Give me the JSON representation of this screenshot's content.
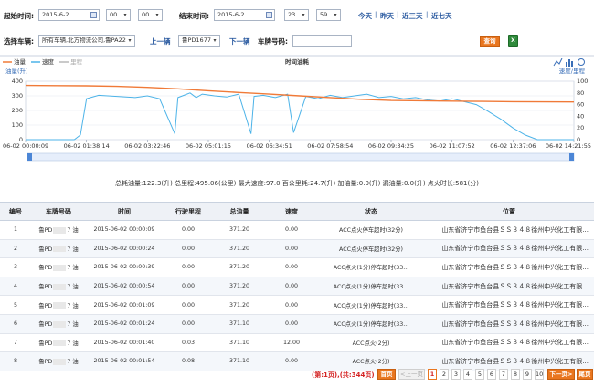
{
  "filters": {
    "start_label": "起始时间:",
    "start_date": "2015-6-2",
    "start_hour": "00",
    "start_minute": "00",
    "end_label": "结束时间:",
    "end_date": "2015-6-2",
    "end_hour": "23",
    "end_minute": "59",
    "quick_links": [
      "今天",
      "昨天",
      "近三天",
      "近七天"
    ],
    "vehicle_label": "选择车辆:",
    "vehicle_value": "所有车辆,北方物流公司,鲁PA228",
    "prev_label": "上一辆",
    "current_vehicle": "鲁PD1677 油",
    "next_label": "下一辆",
    "plate_label": "车牌号码:",
    "plate_value": "",
    "query_label": "查询",
    "export_icon": "excel-icon"
  },
  "chart_data": {
    "type": "line",
    "title": "时间油耗",
    "legend": [
      {
        "name": "油量",
        "color": "#f07a38"
      },
      {
        "name": "速度",
        "color": "#4cb3e8"
      },
      {
        "name": "里程",
        "color": "#b8b8b8"
      }
    ],
    "left_axis_label": "油量(升)",
    "right_axis_label": "速度/里程",
    "left_ylim": [
      0,
      400
    ],
    "left_ticks": [
      0,
      100,
      200,
      300,
      400
    ],
    "right_ylim": [
      0,
      100
    ],
    "right_ticks": [
      0,
      20,
      40,
      60,
      80,
      100
    ],
    "x_ticks": [
      "06-02 00:00:09",
      "06-02 01:38:14",
      "06-02 03:22:46",
      "06-02 05:01:15",
      "06-02 06:34:51",
      "06-02 07:58:54",
      "06-02 09:34:25",
      "06-02 11:07:52",
      "06-02 12:37:06",
      "06-02 14:21:55"
    ],
    "fuel_series": {
      "name": "油量",
      "x_index": [
        0,
        0.5,
        1,
        1.5,
        2,
        2.5,
        3,
        3.5,
        4,
        4.5,
        5,
        5.5,
        6,
        6.5,
        7,
        7.5,
        8,
        8.5,
        9
      ],
      "values": [
        371,
        370,
        369,
        365,
        358,
        348,
        335,
        323,
        312,
        300,
        288,
        276,
        268,
        266,
        264,
        262,
        260,
        259,
        258
      ]
    },
    "speed_series": {
      "name": "速度",
      "x_index": [
        0,
        0.3,
        0.6,
        0.8,
        0.9,
        1.0,
        1.2,
        1.5,
        1.8,
        2.0,
        2.2,
        2.45,
        2.5,
        2.6,
        2.7,
        2.8,
        2.9,
        3.1,
        3.3,
        3.5,
        3.7,
        3.75,
        3.9,
        4.1,
        4.3,
        4.4,
        4.6,
        4.8,
        5.0,
        5.2,
        5.4,
        5.6,
        5.8,
        6.0,
        6.2,
        6.4,
        6.6,
        6.8,
        7.0,
        7.2,
        7.4,
        7.6,
        7.8,
        8.0,
        8.2,
        8.4,
        8.6,
        8.8,
        9.0
      ],
      "values": [
        0,
        0,
        0,
        0,
        8,
        70,
        76,
        74,
        72,
        75,
        70,
        10,
        72,
        76,
        80,
        72,
        78,
        75,
        73,
        78,
        10,
        74,
        76,
        72,
        78,
        12,
        74,
        70,
        76,
        72,
        75,
        78,
        72,
        74,
        70,
        72,
        68,
        66,
        70,
        65,
        60,
        48,
        35,
        20,
        8,
        0,
        0,
        0,
        0
      ]
    }
  },
  "summary": "总耗油量:122.3(升) 总里程:495.06(公里) 最大速度:97.0 百公里耗:24.7(升) 加油量:0.0(升) 漏油量:0.0(升) 点火时长:581(分)",
  "table": {
    "headers": [
      "编号",
      "车牌号码",
      "时间",
      "行驶里程",
      "总油量",
      "速度",
      "状态",
      "位置"
    ],
    "rows": [
      {
        "no": "1",
        "plate_a": "鲁PD",
        "plate_b": "7 油",
        "time": "2015-06-02 00:00:09",
        "mileage": "0.00",
        "fuel": "371.20",
        "speed": "0.00",
        "status": "ACC点火停车超时(32分)",
        "position": "山东省济宁市鱼台县ＳＳ３４８徐州中兴化工有限..."
      },
      {
        "no": "2",
        "plate_a": "鲁PD",
        "plate_b": "7 油",
        "time": "2015-06-02 00:00:24",
        "mileage": "0.00",
        "fuel": "371.20",
        "speed": "0.00",
        "status": "ACC点火停车超时(32分)",
        "position": "山东省济宁市鱼台县ＳＳ３４８徐州中兴化工有限..."
      },
      {
        "no": "3",
        "plate_a": "鲁PD",
        "plate_b": "7 油",
        "time": "2015-06-02 00:00:39",
        "mileage": "0.00",
        "fuel": "371.20",
        "speed": "0.00",
        "status": "ACC点火(1分)停车超时(33...",
        "position": "山东省济宁市鱼台县ＳＳ３４８徐州中兴化工有限..."
      },
      {
        "no": "4",
        "plate_a": "鲁PD",
        "plate_b": "7 油",
        "time": "2015-06-02 00:00:54",
        "mileage": "0.00",
        "fuel": "371.20",
        "speed": "0.00",
        "status": "ACC点火(1分)停车超时(33...",
        "position": "山东省济宁市鱼台县ＳＳ３４８徐州中兴化工有限..."
      },
      {
        "no": "5",
        "plate_a": "鲁PD",
        "plate_b": "7 油",
        "time": "2015-06-02 00:01:09",
        "mileage": "0.00",
        "fuel": "371.20",
        "speed": "0.00",
        "status": "ACC点火(1分)停车超时(33...",
        "position": "山东省济宁市鱼台县ＳＳ３４８徐州中兴化工有限..."
      },
      {
        "no": "6",
        "plate_a": "鲁PD",
        "plate_b": "7 油",
        "time": "2015-06-02 00:01:24",
        "mileage": "0.00",
        "fuel": "371.10",
        "speed": "0.00",
        "status": "ACC点火(1分)停车超时(33...",
        "position": "山东省济宁市鱼台县ＳＳ３４８徐州中兴化工有限..."
      },
      {
        "no": "7",
        "plate_a": "鲁PD",
        "plate_b": "7 油",
        "time": "2015-06-02 00:01:40",
        "mileage": "0.03",
        "fuel": "371.10",
        "speed": "12.00",
        "status": "ACC点火(2分)",
        "position": "山东省济宁市鱼台县ＳＳ３４８徐州中兴化工有限..."
      },
      {
        "no": "8",
        "plate_a": "鲁PD",
        "plate_b": "7 油",
        "time": "2015-06-02 00:01:54",
        "mileage": "0.08",
        "fuel": "371.10",
        "speed": "0.00",
        "status": "ACC点火(2分)",
        "position": "山东省济宁市鱼台县ＳＳ３４８徐州中兴化工有限..."
      }
    ]
  },
  "pager": {
    "info": "(第:1页),(共:344页)",
    "first": "首页",
    "prev": "<上一页",
    "pages": [
      "1",
      "2",
      "3",
      "4",
      "5",
      "6",
      "7",
      "8",
      "9",
      "10"
    ],
    "current": "1",
    "next": "下一页>",
    "last": "尾页"
  }
}
